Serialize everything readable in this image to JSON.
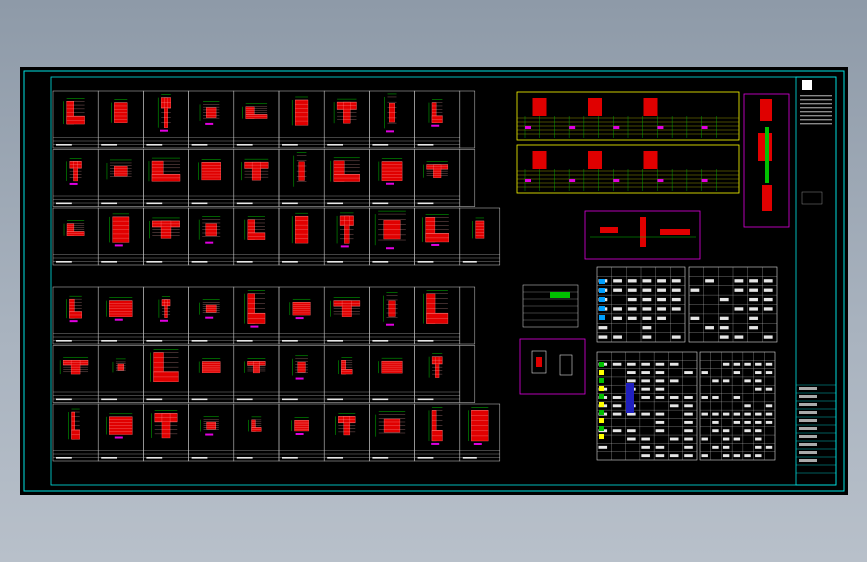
{
  "viewer": {
    "background": "#9aa4b0",
    "canvas_color": "#000000"
  },
  "drawing": {
    "border_color": "#00e5e5",
    "wall_fill_color": "#e00000",
    "dimension_color": "#ffffff",
    "callout_color": "#e000e0",
    "frame_color": "#ffff00",
    "grid_color": "#00c000",
    "column_section_panels": {
      "upper_rows": 3,
      "lower_rows": 3,
      "panels_per_row": 10
    },
    "title_block": {
      "present": true,
      "text_legible": false
    }
  }
}
